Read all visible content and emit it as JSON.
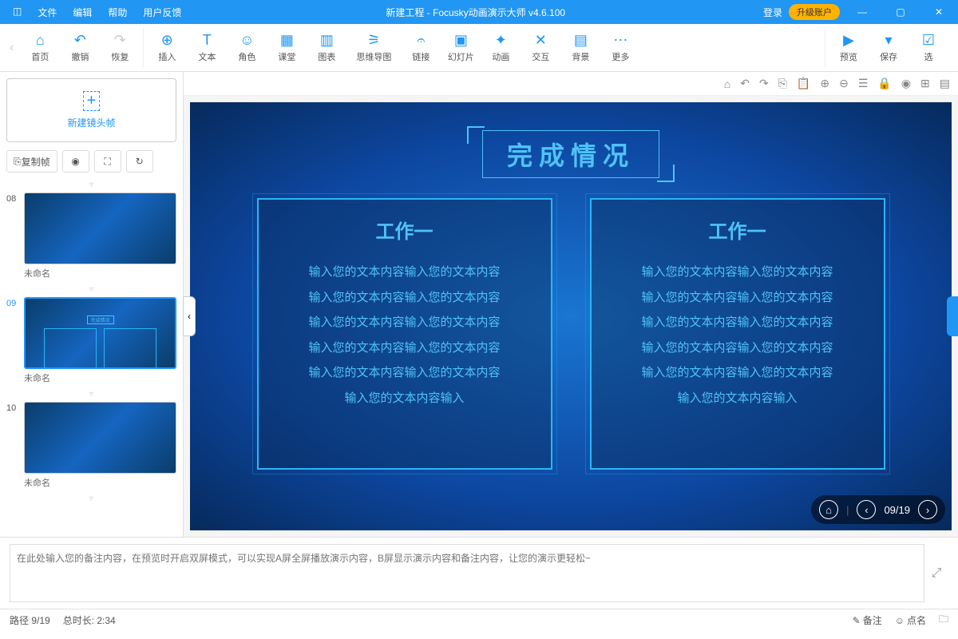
{
  "titlebar": {
    "menus": [
      "文件",
      "编辑",
      "帮助",
      "用户反馈"
    ],
    "title": "新建工程 - Focusky动画演示大师  v4.6.100",
    "login": "登录",
    "upgrade": "升级账户"
  },
  "toolbar": {
    "home": "首页",
    "undo": "撤销",
    "redo": "恢复",
    "insert": "插入",
    "text": "文本",
    "role": "角色",
    "class": "课堂",
    "chart": "图表",
    "mindmap": "思维导图",
    "link": "链接",
    "slide": "幻灯片",
    "anim": "动画",
    "interact": "交互",
    "bg": "背景",
    "more": "更多",
    "preview": "预览",
    "save": "保存",
    "select": "选"
  },
  "sidebar": {
    "newframe": "新建镜头帧",
    "copy": "复制帧",
    "thumbs": [
      {
        "n": "08",
        "name": "未命名"
      },
      {
        "n": "09",
        "name": "未命名"
      },
      {
        "n": "10",
        "name": "未命名"
      }
    ]
  },
  "slide": {
    "title": "完成情况",
    "panels": [
      {
        "h": "工作一",
        "lines": [
          "输入您的文本内容输入您的文本内容",
          "输入您的文本内容输入您的文本内容",
          "输入您的文本内容输入您的文本内容",
          "输入您的文本内容输入您的文本内容",
          "输入您的文本内容输入您的文本内容",
          "输入您的文本内容输入"
        ]
      },
      {
        "h": "工作一",
        "lines": [
          "输入您的文本内容输入您的文本内容",
          "输入您的文本内容输入您的文本内容",
          "输入您的文本内容输入您的文本内容",
          "输入您的文本内容输入您的文本内容",
          "输入您的文本内容输入您的文本内容",
          "输入您的文本内容输入"
        ]
      }
    ],
    "nav": "09/19"
  },
  "notes": {
    "placeholder": "在此处输入您的备注内容，在预览时开启双屏模式，可以实现A屏全屏播放演示内容，B屏显示演示内容和备注内容，让您的演示更轻松~"
  },
  "status": {
    "path": "路径 9/19",
    "duration": "总时长: 2:34",
    "note": "备注",
    "click": "点名"
  }
}
